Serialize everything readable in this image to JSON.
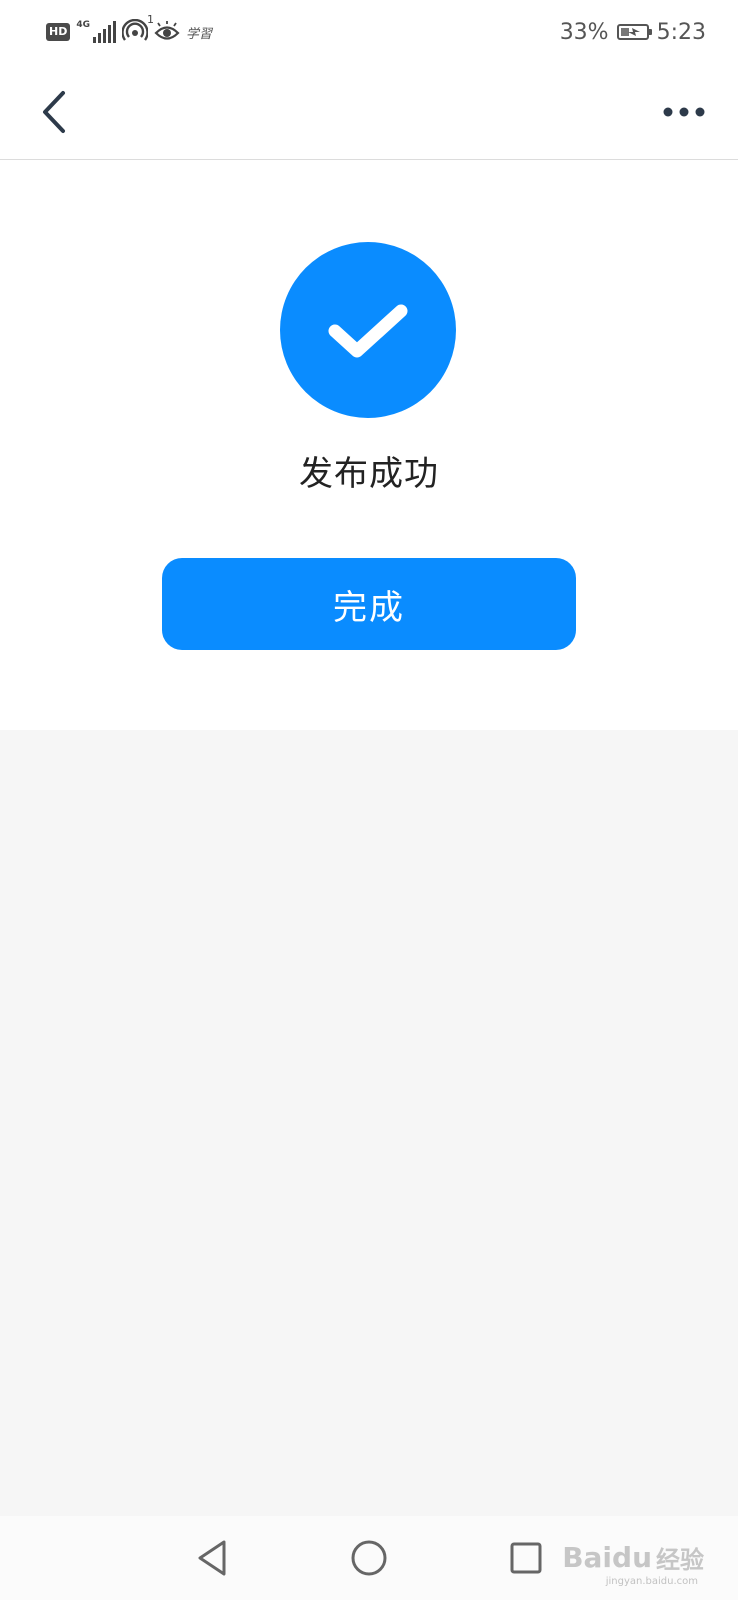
{
  "status_bar": {
    "hd_label": "HD",
    "network_label": "4G",
    "hotspot_count": "1",
    "signature_text": "学習",
    "battery_percent": "33%",
    "battery_level": 0.33,
    "time": "5:23",
    "icons": [
      "hd-icon",
      "signal-icon",
      "hotspot-icon",
      "eye-icon",
      "battery-charging-icon"
    ]
  },
  "nav": {
    "back_icon": "chevron-left-icon",
    "more_icon": "more-dots-icon"
  },
  "success": {
    "icon": "check-circle-icon",
    "message": "发布成功"
  },
  "actions": {
    "done_label": "完成"
  },
  "system_nav": {
    "icons": [
      "back-triangle-icon",
      "home-circle-icon",
      "recent-square-icon"
    ]
  },
  "watermark": {
    "brand": "Baidu",
    "suffix": "经验",
    "url": "jingyan.baidu.com"
  },
  "colors": {
    "accent": "#0a8cff",
    "background": "#f6f6f6",
    "surface": "#ffffff",
    "text": "#222222"
  }
}
